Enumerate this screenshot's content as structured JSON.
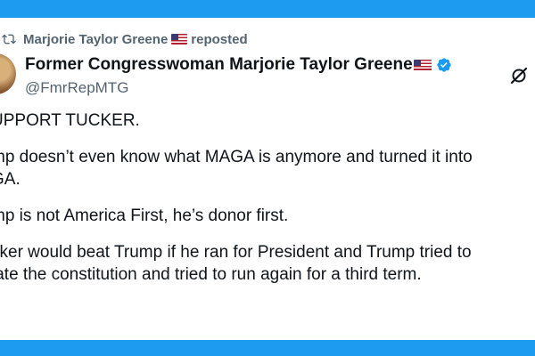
{
  "repost": {
    "label_name": "Marjorie Taylor Greene",
    "label_suffix": "reposted",
    "icon": "repost-icon",
    "flag_icon": "us-flag-icon"
  },
  "author": {
    "display_name": "Former Congresswoman Marjorie Taylor Greene",
    "handle": "@FmrRepMTG",
    "verified_icon": "verified-badge-icon",
    "verified_color": "#1d9bf0"
  },
  "header_action": {
    "icon": "grok-icon"
  },
  "post": {
    "paragraphs": [
      "UPPORT TUCKER.",
      "mp doesn’t even know what MAGA is anymore and turned it into\nGA.",
      "mp is not America First, he’s donor first.",
      "cker would beat Trump if he ran for President and Trump tried to\nlate the constitution and tried to run again for a third term."
    ]
  },
  "colors": {
    "frame": "#1d9bf0",
    "text": "#0f1419",
    "secondary_text": "#536471"
  }
}
